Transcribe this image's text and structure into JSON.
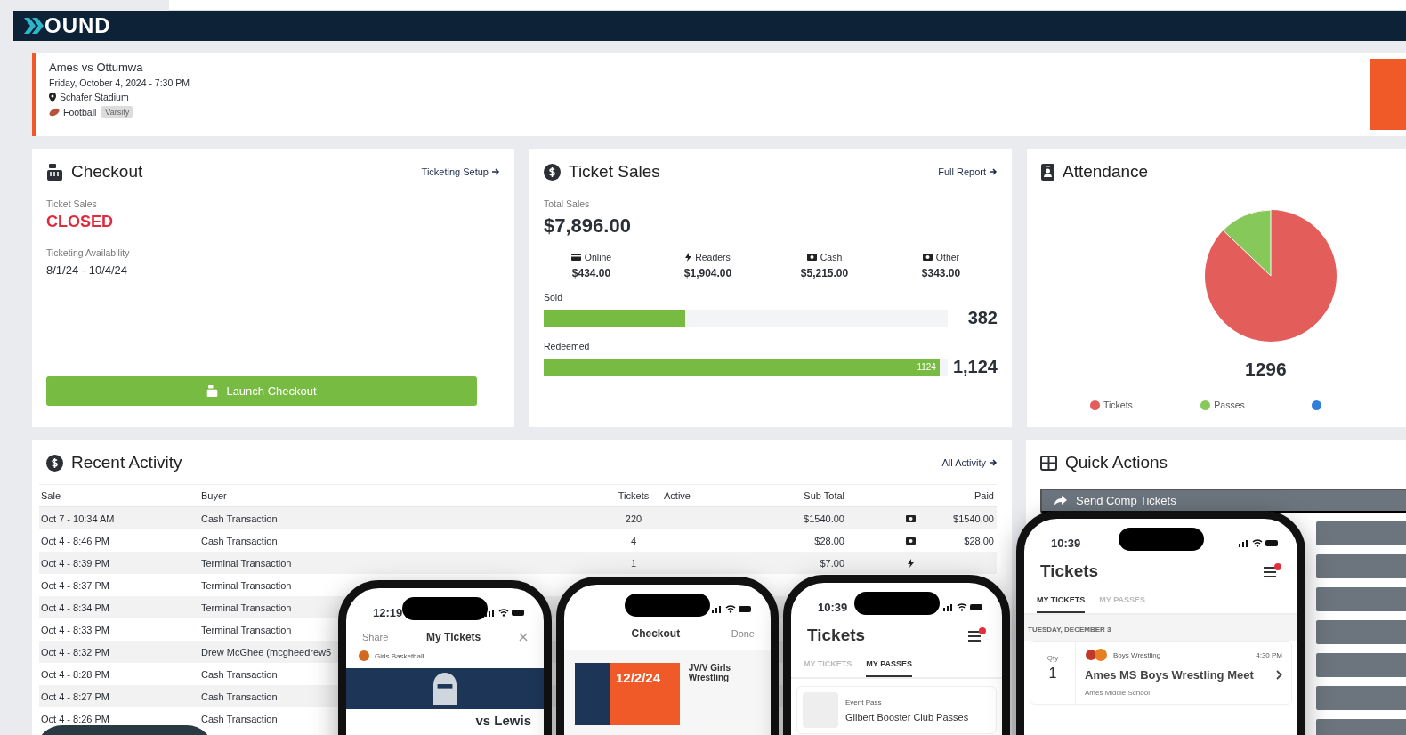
{
  "header": {
    "logo_text": "OUND"
  },
  "event": {
    "title": "Ames vs Ottumwa",
    "date": "Friday, October 4, 2024 - 7:30 PM",
    "venue": "Schafer Stadium",
    "sport": "Football",
    "level_tag": "Varsity"
  },
  "checkout": {
    "title": "Checkout",
    "link": "Ticketing Setup",
    "sales_label": "Ticket Sales",
    "sales_status": "CLOSED",
    "availability_label": "Ticketing Availability",
    "availability": "8/1/24 - 10/4/24",
    "button": "Launch Checkout"
  },
  "ticket_sales": {
    "title": "Ticket Sales",
    "link": "Full Report",
    "total_label": "Total Sales",
    "total": "$7,896.00",
    "breakdown": [
      {
        "kind": "online",
        "label": "Online",
        "amount": "$434.00"
      },
      {
        "kind": "readers",
        "label": "Readers",
        "amount": "$1,904.00"
      },
      {
        "kind": "cash",
        "label": "Cash",
        "amount": "$5,215.00"
      },
      {
        "kind": "other",
        "label": "Other",
        "amount": "$343.00"
      }
    ],
    "bars": [
      {
        "label": "Sold",
        "level": 0.35,
        "count": "382"
      },
      {
        "label": "Redeemed",
        "level": 0.98,
        "bar_label": "1124",
        "count": "1,124"
      }
    ]
  },
  "attendance": {
    "title": "Attendance",
    "total": "1296",
    "legend": [
      {
        "label": "Tickets",
        "color": "#e35d5b"
      },
      {
        "label": "Passes",
        "color": "#86c95a"
      },
      {
        "color": "#2f7ed8"
      }
    ]
  },
  "recent_activity": {
    "title": "Recent Activity",
    "link": "All Activity",
    "columns": [
      "Sale",
      "Buyer",
      "Tickets",
      "Active",
      "Sub Total",
      "Paid"
    ],
    "rows": [
      {
        "sale": "Oct 7 - 10:34 AM",
        "buyer": "Cash Transaction",
        "tickets": "220",
        "sub_total": "$1540.00",
        "kind": "cash",
        "paid": "$1540.00"
      },
      {
        "sale": "Oct 4 - 8:46 PM",
        "buyer": "Cash Transaction",
        "tickets": "4",
        "sub_total": "$28.00",
        "kind": "cash",
        "paid": "$28.00"
      },
      {
        "sale": "Oct 4 - 8:39 PM",
        "buyer": "Terminal Transaction",
        "tickets": "1",
        "sub_total": "$7.00",
        "kind": "reader"
      },
      {
        "sale": "Oct 4 - 8:37 PM",
        "buyer": "Terminal Transaction"
      },
      {
        "sale": "Oct 4 - 8:34 PM",
        "buyer": "Terminal Transaction"
      },
      {
        "sale": "Oct 4 - 8:33 PM",
        "buyer": "Terminal Transaction"
      },
      {
        "sale": "Oct 4 - 8:32 PM",
        "buyer": "Drew McGhee  (mcgheedrew5"
      },
      {
        "sale": "Oct 4 - 8:28 PM",
        "buyer": "Cash Transaction"
      },
      {
        "sale": "Oct 4 - 8:27 PM",
        "buyer": "Cash Transaction"
      },
      {
        "sale": "Oct 4 - 8:26 PM",
        "buyer": "Cash Transaction"
      }
    ]
  },
  "quick_actions": {
    "title": "Quick Actions",
    "actions": [
      {
        "kind": "labeled",
        "label": "Send Comp Tickets"
      },
      {
        "kind": "covered"
      },
      {
        "kind": "covered"
      },
      {
        "kind": "covered"
      },
      {
        "kind": "covered"
      },
      {
        "kind": "covered"
      },
      {
        "kind": "covered"
      },
      {
        "kind": "covered"
      }
    ]
  },
  "phones": [
    {
      "kind": "my_tickets",
      "time": "12:19",
      "title": "My Tickets",
      "left_action": "Share",
      "category": "Girls Basketball",
      "event": "vs Lewis"
    },
    {
      "kind": "checkout",
      "title": "Checkout",
      "right_action": "Done",
      "date_graphic": "12/2/24",
      "event": "JV/V Girls Wrestling"
    },
    {
      "kind": "ticket_list",
      "time": "10:39",
      "title": "Tickets",
      "tabs": [
        {
          "label": "MY TICKETS",
          "selected": false
        },
        {
          "label": "MY PASSES",
          "selected": true
        }
      ],
      "items": [
        {
          "kind": "pass",
          "category": "Event Pass",
          "name": "Gilbert Booster Club Passes"
        }
      ]
    },
    {
      "kind": "ticket_list",
      "time": "10:39",
      "title": "Tickets",
      "tabs": [
        {
          "label": "MY TICKETS",
          "selected": true
        },
        {
          "label": "MY PASSES",
          "selected": false
        }
      ],
      "day": "TUESDAY, DECEMBER 3",
      "items": [
        {
          "kind": "ticket",
          "qty_label": "Qty",
          "qty": "1",
          "category": "Boys Wrestling",
          "time": "4:30 PM",
          "name": "Ames MS Boys Wrestling Meet",
          "venue": "Ames Middle School"
        }
      ]
    }
  ]
}
